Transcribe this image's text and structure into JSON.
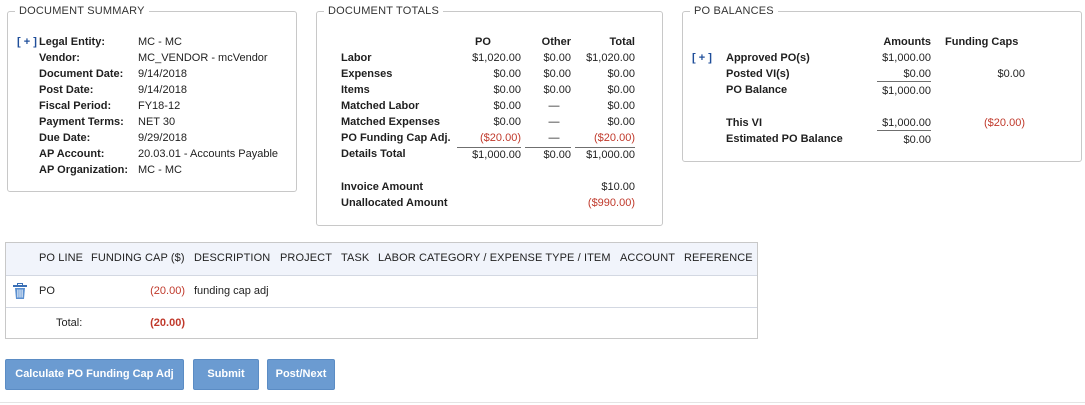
{
  "summary": {
    "title": "DOCUMENT SUMMARY",
    "expand": "[ + ]",
    "rows": [
      {
        "label": "Legal Entity:",
        "value": "MC - MC"
      },
      {
        "label": "Vendor:",
        "value": "MC_VENDOR - mcVendor"
      },
      {
        "label": "Document Date:",
        "value": "9/14/2018"
      },
      {
        "label": "Post Date:",
        "value": "9/14/2018"
      },
      {
        "label": "Fiscal Period:",
        "value": "FY18-12"
      },
      {
        "label": "Payment Terms:",
        "value": "NET 30"
      },
      {
        "label": "Due Date:",
        "value": "9/29/2018"
      },
      {
        "label": "AP Account:",
        "value": "20.03.01 - Accounts Payable"
      },
      {
        "label": "AP Organization:",
        "value": "MC - MC"
      }
    ]
  },
  "totals": {
    "title": "DOCUMENT TOTALS",
    "headers": {
      "po": "PO",
      "other": "Other",
      "total": "Total"
    },
    "rows": [
      {
        "label": "Labor",
        "po": "$1,020.00",
        "other": "$0.00",
        "total": "$1,020.00"
      },
      {
        "label": "Expenses",
        "po": "$0.00",
        "other": "$0.00",
        "total": "$0.00"
      },
      {
        "label": "Items",
        "po": "$0.00",
        "other": "$0.00",
        "total": "$0.00"
      },
      {
        "label": "Matched Labor",
        "po": "$0.00",
        "other": "—",
        "total": "$0.00"
      },
      {
        "label": "Matched Expenses",
        "po": "$0.00",
        "other": "—",
        "total": "$0.00"
      },
      {
        "label": "PO Funding Cap Adj.",
        "po": "($20.00)",
        "other": "—",
        "total": "($20.00)"
      },
      {
        "label": "Details Total",
        "po": "$1,000.00",
        "other": "$0.00",
        "total": "$1,000.00"
      }
    ],
    "invoice_label": "Invoice Amount",
    "invoice_value": "$10.00",
    "unallocated_label": "Unallocated Amount",
    "unallocated_value": "($990.00)"
  },
  "balances": {
    "title": "PO BALANCES",
    "expand": "[ + ]",
    "headers": {
      "amounts": "Amounts",
      "caps": "Funding Caps"
    },
    "rows": [
      {
        "label": "Approved PO(s)",
        "amount": "$1,000.00",
        "cap": ""
      },
      {
        "label": "Posted VI(s)",
        "amount": "$0.00",
        "cap": "$0.00"
      },
      {
        "label": "PO Balance",
        "amount": "$1,000.00",
        "cap": ""
      },
      {
        "label": "This VI",
        "amount": "$1,000.00",
        "cap": "($20.00)"
      },
      {
        "label": "Estimated PO Balance",
        "amount": "$0.00",
        "cap": ""
      }
    ]
  },
  "grid": {
    "columns": [
      "PO LINE",
      "FUNDING CAP ($)",
      "DESCRIPTION",
      "PROJECT",
      "TASK",
      "LABOR CATEGORY / EXPENSE TYPE / ITEM",
      "ACCOUNT",
      "REFERENCE"
    ],
    "row": {
      "po_line": "PO",
      "funding_cap": "(20.00)",
      "description": "funding cap adj"
    },
    "total_label": "Total:",
    "total_value": "(20.00)"
  },
  "buttons": {
    "calculate": "Calculate PO Funding Cap Adj",
    "submit": "Submit",
    "post_next": "Post/Next"
  },
  "colors": {
    "accent": "#6b9bd1",
    "negative": "#c0392b",
    "header_bg": "#f1f4fb"
  }
}
